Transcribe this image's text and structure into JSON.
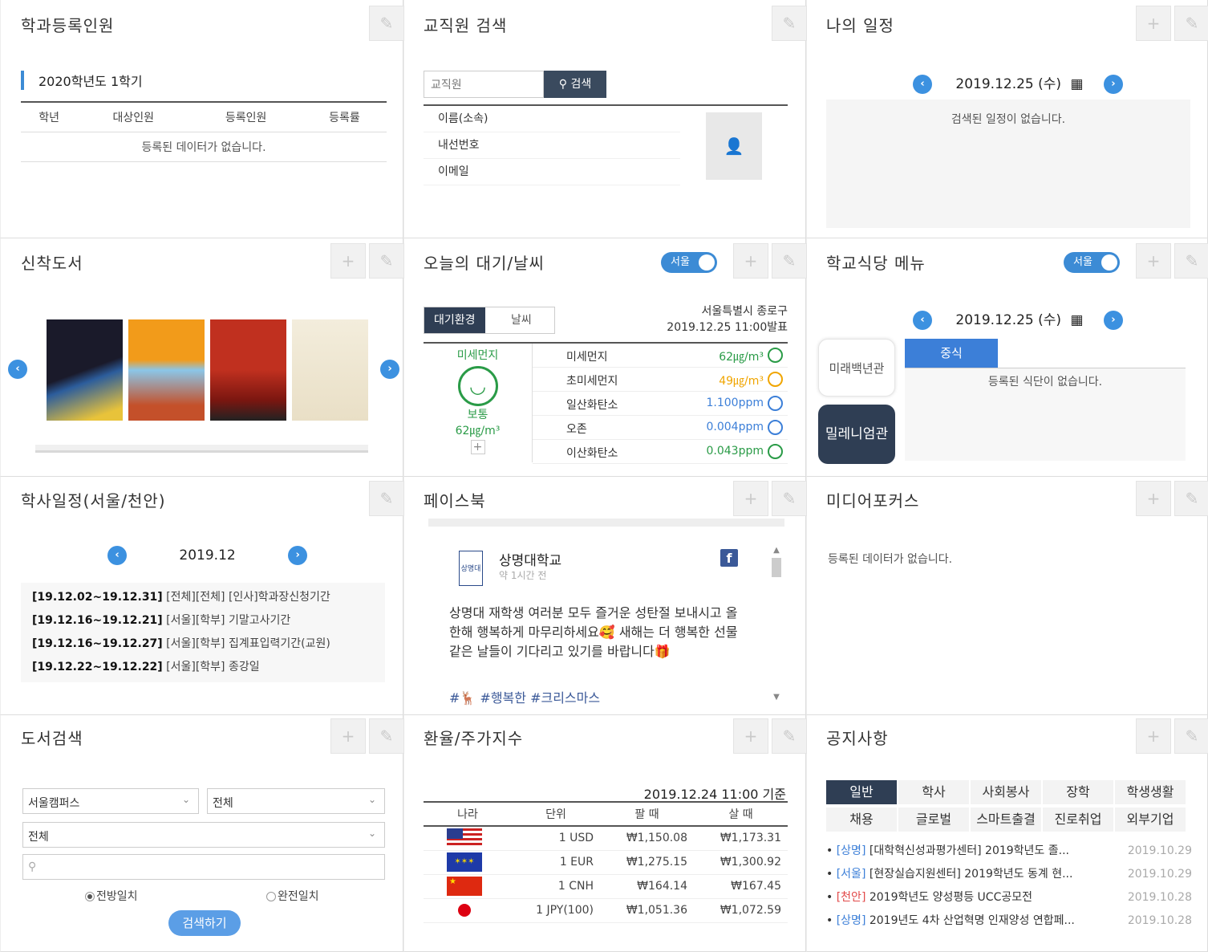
{
  "panels": {
    "enroll": {
      "title": "학과등록인원",
      "semester": "2020학년도 1학기",
      "columns": [
        "학년",
        "대상인원",
        "등록인원",
        "등록률"
      ],
      "empty": "등록된 데이터가 없습니다."
    },
    "staff": {
      "title": "교직원 검색",
      "placeholder": "교직원",
      "search_label": "검색",
      "fields": [
        "이름(소속)",
        "내선번호",
        "이메일"
      ]
    },
    "schedule": {
      "title": "나의 일정",
      "date": "2019.12.25 (수)",
      "empty": "검색된 일정이 없습니다."
    },
    "books": {
      "title": "신착도서"
    },
    "air": {
      "title": "오늘의 대기/날씨",
      "toggle": "서울",
      "tabs": [
        "대기환경",
        "날씨"
      ],
      "location": "서울특별시 종로구",
      "issued": "2019.12.25 11:00발표",
      "summary": {
        "label": "미세먼지",
        "status": "보통",
        "value": "62㎍/m³",
        "plus": "+"
      },
      "rows": [
        {
          "name": "미세먼지",
          "value": "62㎍/m³",
          "color": "#2a9b47"
        },
        {
          "name": "초미세먼지",
          "value": "49㎍/m³",
          "color": "#f0a500"
        },
        {
          "name": "일산화탄소",
          "value": "1.100ppm",
          "color": "#3c7fd8"
        },
        {
          "name": "오존",
          "value": "0.004ppm",
          "color": "#3c7fd8"
        },
        {
          "name": "이산화탄소",
          "value": "0.043ppm",
          "color": "#2a9b47"
        }
      ]
    },
    "cafeteria": {
      "title": "학교식당 메뉴",
      "toggle": "서울",
      "date": "2019.12.25 (수)",
      "halls": [
        "미래백년관",
        "밀레니엄관"
      ],
      "meal": "중식",
      "empty": "등록된 식단이 없습니다."
    },
    "academic": {
      "title": "학사일정(서울/천안)",
      "month": "2019.12",
      "items": [
        {
          "range": "[19.12.02~19.12.31]",
          "text": "[전체][전체] [인사]학과장신청기간"
        },
        {
          "range": "[19.12.16~19.12.21]",
          "text": "[서울][학부] 기말고사기간"
        },
        {
          "range": "[19.12.16~19.12.27]",
          "text": "[서울][학부] 집계표입력기간(교원)"
        },
        {
          "range": "[19.12.22~19.12.22]",
          "text": "[서울][학부] 종강일"
        }
      ]
    },
    "facebook": {
      "title": "페이스북",
      "page": "상명대학교",
      "time": "약 1시간 전",
      "logo": "상명대",
      "post": "상명대 재학생 여러분 모두 즐거운 성탄절 보내시고 올 한해 행복하게 마무리하세요🥰 새해는 더 행복한 선물 같은 날들이 기다리고 있기를 바랍니다🎁",
      "tags": "#🦌 #행복한 #크리스마스"
    },
    "media": {
      "title": "미디어포커스",
      "empty": "등록된 데이터가 없습니다."
    },
    "booksearch": {
      "title": "도서검색",
      "campus": "서울캠퍼스",
      "scope": "전체",
      "field": "전체",
      "radio1": "전방일치",
      "radio2": "완전일치",
      "button": "검색하기"
    },
    "fx": {
      "title": "환율/주가지수",
      "date": "2019.12.24 11:00 기준",
      "columns": [
        "나라",
        "단위",
        "팔 때",
        "살 때"
      ],
      "rows": [
        {
          "unit": "1 USD",
          "sell": "₩1,150.08",
          "buy": "₩1,173.31",
          "flag": "us"
        },
        {
          "unit": "1 EUR",
          "sell": "₩1,275.15",
          "buy": "₩1,300.92",
          "flag": "eu"
        },
        {
          "unit": "1 CNH",
          "sell": "₩164.14",
          "buy": "₩167.45",
          "flag": "cn"
        },
        {
          "unit": "1 JPY(100)",
          "sell": "₩1,051.36",
          "buy": "₩1,072.59",
          "flag": "jp"
        }
      ]
    },
    "notice": {
      "title": "공지사항",
      "tabs": [
        "일반",
        "학사",
        "사회봉사",
        "장학",
        "학생생활",
        "채용",
        "글로벌",
        "스마트출결",
        "진로취업",
        "외부기업"
      ],
      "items": [
        {
          "tag": "[상명]",
          "text": "[대학혁신성과평가센터] 2019학년도 졸...",
          "date": "2019.10.29"
        },
        {
          "tag": "[서울]",
          "text": "[현장실습지원센터] 2019학년도 동계 현...",
          "date": "2019.10.29"
        },
        {
          "tag": "[천안]",
          "text": "2019학년도 양성평등 UCC공모전",
          "date": "2019.10.28"
        },
        {
          "tag": "[상명]",
          "text": "2019년도 4차 산업혁명 인재양성 연합페...",
          "date": "2019.10.28"
        }
      ]
    }
  }
}
